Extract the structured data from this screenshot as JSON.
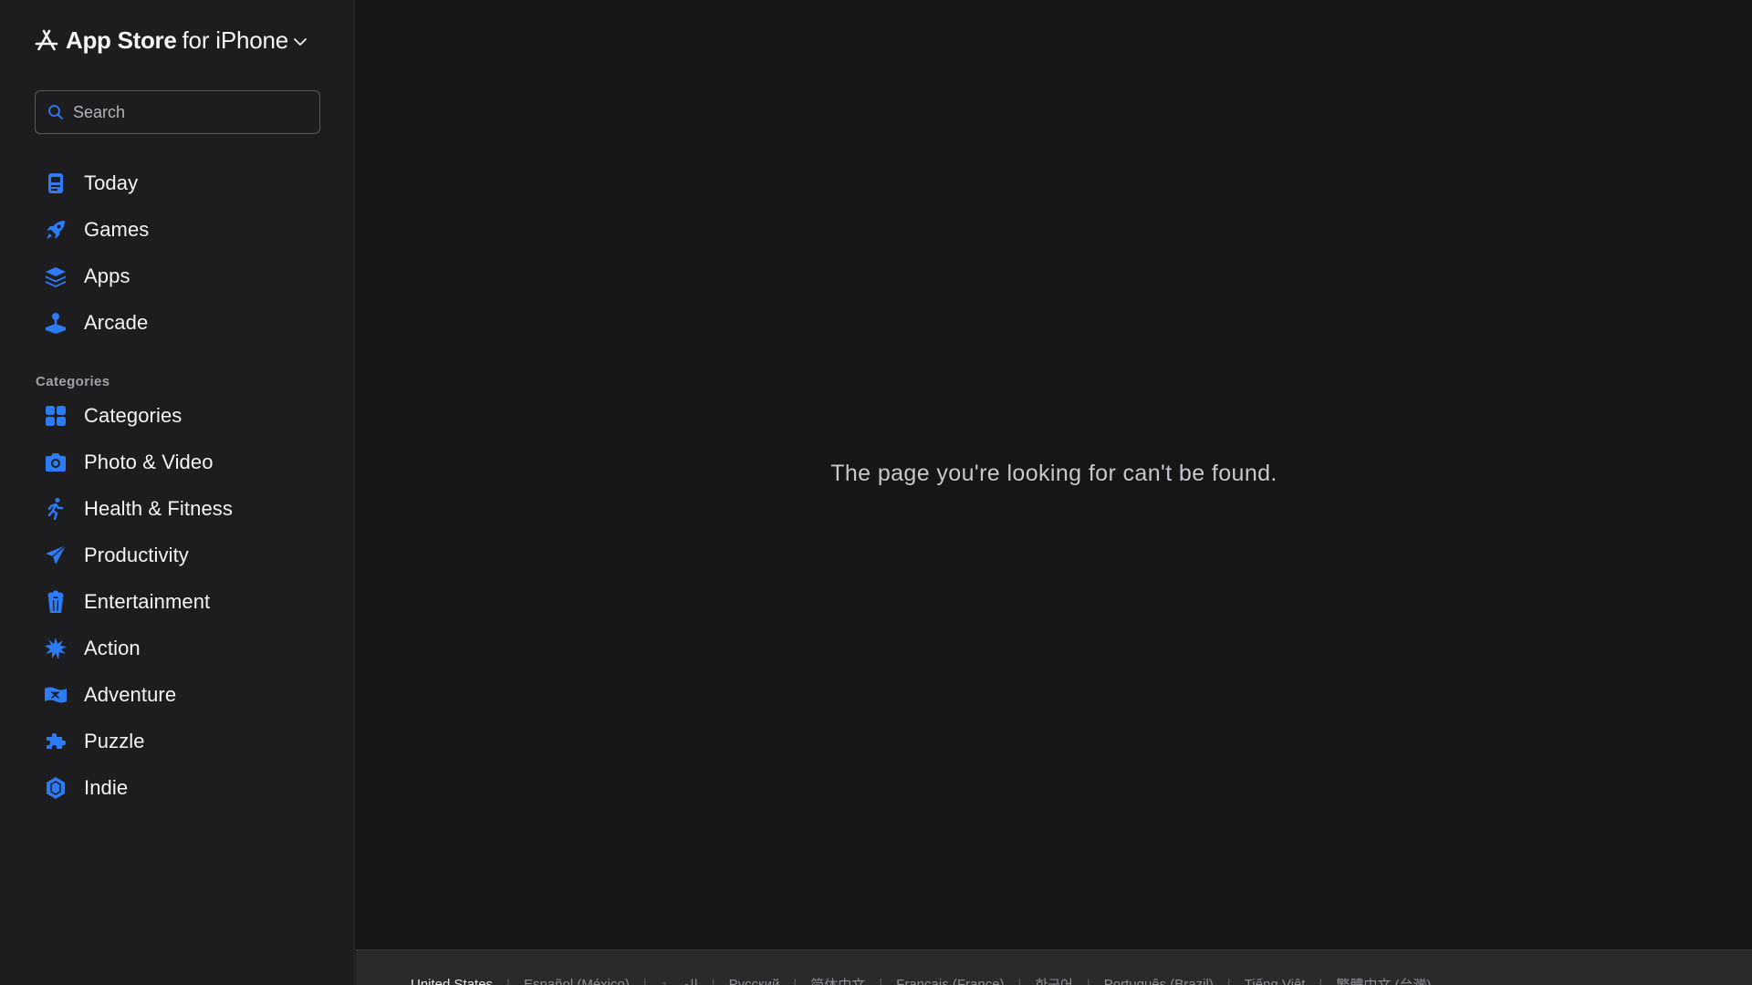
{
  "brand": {
    "store": "App Store",
    "platform": "for iPhone"
  },
  "search": {
    "placeholder": "Search",
    "value": ""
  },
  "nav_top": [
    {
      "label": "Today",
      "icon": "today-icon"
    },
    {
      "label": "Games",
      "icon": "rocket-icon"
    },
    {
      "label": "Apps",
      "icon": "layers-icon"
    },
    {
      "label": "Arcade",
      "icon": "joystick-icon"
    }
  ],
  "categories_heading": "Categories",
  "nav_categories": [
    {
      "label": "Categories",
      "icon": "grid-icon"
    },
    {
      "label": "Photo & Video",
      "icon": "camera-icon"
    },
    {
      "label": "Health & Fitness",
      "icon": "runner-icon"
    },
    {
      "label": "Productivity",
      "icon": "paperplane-icon"
    },
    {
      "label": "Entertainment",
      "icon": "popcorn-icon"
    },
    {
      "label": "Action",
      "icon": "burst-icon"
    },
    {
      "label": "Adventure",
      "icon": "flag-icon"
    },
    {
      "label": "Puzzle",
      "icon": "puzzle-icon"
    },
    {
      "label": "Indie",
      "icon": "hexagon-icon"
    }
  ],
  "main": {
    "message": "The page you're looking for can't be found."
  },
  "footer": {
    "languages": [
      "United States",
      "Español (México)",
      "العربية",
      "Русский",
      "简体中文",
      "Français (France)",
      "한국어",
      "Português (Brazil)",
      "Tiếng Việt",
      "繁體中文 (台灣)"
    ]
  },
  "colors": {
    "accent": "#2d7cf6",
    "background": "#161617",
    "sidebar": "#1d1d1f"
  }
}
